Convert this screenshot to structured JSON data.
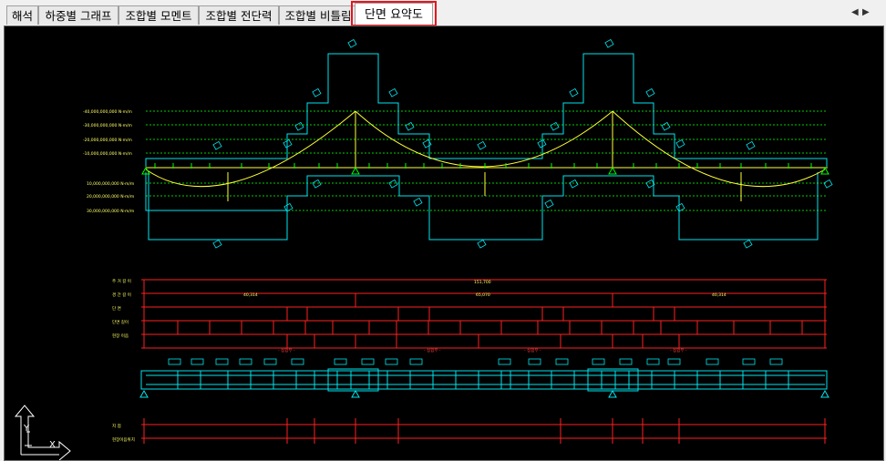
{
  "tabs": [
    {
      "label": "해석",
      "active": false
    },
    {
      "label": "하중별 그래프",
      "active": false
    },
    {
      "label": "조합별 모멘트",
      "active": false
    },
    {
      "label": "조합별 전단력",
      "active": false
    },
    {
      "label": "조합별 비틀림",
      "active": false
    },
    {
      "label": "단면 요약도",
      "active": true
    }
  ],
  "nav": {
    "left_arrow": "◀",
    "right_arrow": "▶"
  },
  "diagram": {
    "moment_levels_negative": [
      "-40,000,000,000 N·m/m",
      "-30,000,000,000 N·m/m",
      "-20,000,000,000 N·m/m",
      "-10,000,000,000 N·m/m"
    ],
    "moment_levels_positive": [
      "10,000,000,000 N·m/m",
      "20,000,000,000 N·m/m",
      "30,000,000,000 N·m/m"
    ],
    "table_labels": [
      "주 거 길 이",
      "경 간 길 이",
      "단 면",
      "단면 길이",
      "현장 이음"
    ],
    "total_length": "151,700",
    "span_lengths": [
      "40,314",
      "65,070",
      "40,314"
    ],
    "section_marks": [
      "- 접합부 -",
      "- 접합부 -",
      "- 접합부 -",
      "- 접합부 -"
    ],
    "bottom_labels": [
      "지 점",
      "현장이음위치"
    ],
    "axis_labels": {
      "y": "Y",
      "x": "X"
    }
  },
  "colors": {
    "cyan": "#00e5ee",
    "yellow": "#ffff33",
    "green": "#00ff00",
    "red": "#ff2020",
    "highlight": "#e8141e"
  }
}
